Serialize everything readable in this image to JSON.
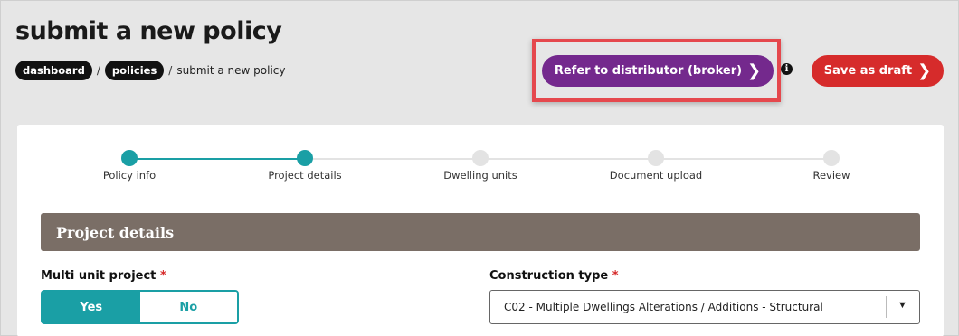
{
  "page": {
    "title": "submit a new policy"
  },
  "breadcrumb": {
    "items": [
      "dashboard",
      "policies"
    ],
    "separator": "/",
    "current": "submit a new policy"
  },
  "actions": {
    "refer_label": "Refer to distributor (broker)",
    "info_icon": "i",
    "draft_label": "Save as draft"
  },
  "stepper": {
    "steps": [
      {
        "label": "Policy info",
        "status": "complete"
      },
      {
        "label": "Project details",
        "status": "current"
      },
      {
        "label": "Dwelling units",
        "status": "upcoming"
      },
      {
        "label": "Document upload",
        "status": "upcoming"
      },
      {
        "label": "Review",
        "status": "upcoming"
      }
    ]
  },
  "section": {
    "title": "Project details"
  },
  "fields": {
    "multi_unit": {
      "label": "Multi unit project",
      "required_mark": "*",
      "options": [
        "Yes",
        "No"
      ],
      "selected": "Yes"
    },
    "construction_type": {
      "label": "Construction type",
      "required_mark": "*",
      "value": "C02 - Multiple Dwellings Alterations / Additions - Structural"
    }
  },
  "colors": {
    "accent_teal": "#1a9fa5",
    "refer_purple": "#74298d",
    "draft_red": "#d62b2b",
    "section_header": "#7a6e66",
    "highlight_red": "#e5484d"
  },
  "icons": [
    "chevron-right-icon",
    "info-icon",
    "chevron-down-icon"
  ]
}
